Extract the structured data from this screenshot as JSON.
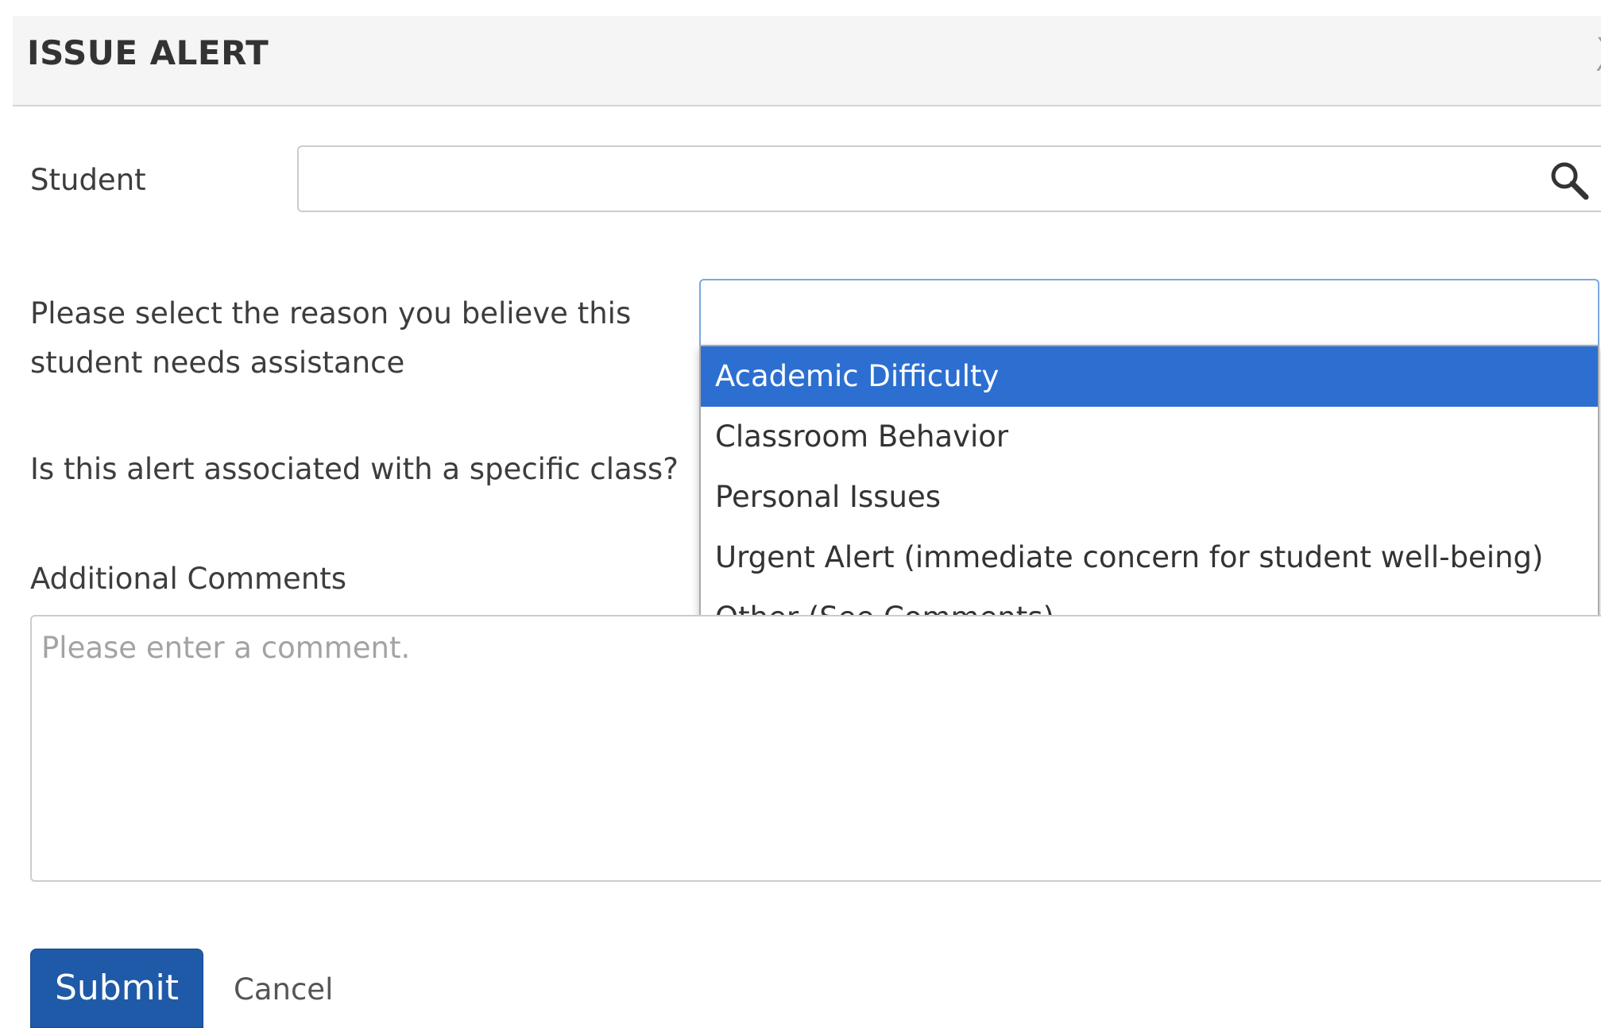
{
  "dialog": {
    "title": "ISSUE ALERT",
    "close_label": "X"
  },
  "form": {
    "student_label": "Student",
    "student_value": "",
    "reason_label": "Please select the reason you believe this student needs assistance",
    "reason_value": "",
    "reason_options": [
      "Academic Difficulty",
      "Classroom Behavior",
      "Personal Issues",
      "Urgent Alert (immediate concern for student well-being)",
      "Other (See Comments)"
    ],
    "reason_highlighted": "Academic Difficulty",
    "class_label": "Is this alert associated with a specific class?",
    "comments_label": "Additional Comments",
    "comments_placeholder": "Please enter a comment."
  },
  "actions": {
    "submit_label": "Submit",
    "cancel_label": "Cancel"
  },
  "icons": {
    "search": "search-icon",
    "close": "close-icon"
  },
  "colors": {
    "accent": "#2c6fd1",
    "submit": "#1f5aa8",
    "header_bg": "#f5f5f5"
  }
}
